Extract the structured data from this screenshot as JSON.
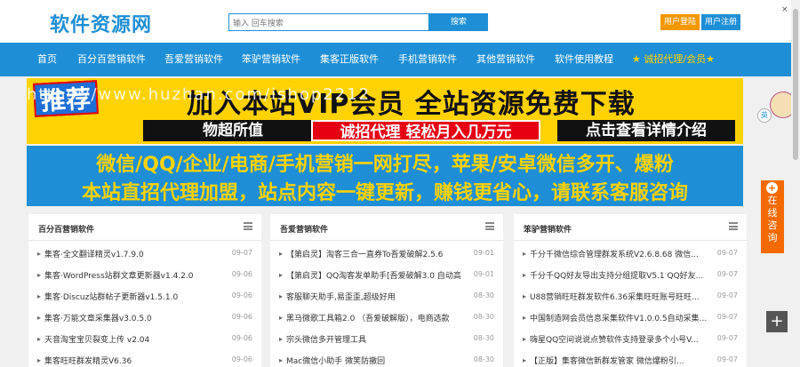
{
  "header": {
    "logo": "软件资源网",
    "search_placeholder": "输入 回车搜索",
    "search_button": "搜索",
    "login": "用户登陆",
    "register": "用户注册",
    "close": "×"
  },
  "nav": [
    "首页",
    "百分百营销软件",
    "吾爱营销软件",
    "笨驴营销软件",
    "集客正版软件",
    "手机营销软件",
    "其他营销软件",
    "软件使用教程",
    "★ 诚招代理/会员★"
  ],
  "banner1": {
    "tag": "推荐",
    "headline": "加入本站VIP会员 全站资源免费下载",
    "watermark": "https://www.huzhan.com/ishop2212",
    "pill1": "物超所值",
    "pill2": "诚招代理 轻松月入几万元",
    "pill3": "点击查看详情介绍"
  },
  "banner2": {
    "line1": "微信/QQ/企业/电商/手机营销一网打尽，苹果/安卓微信多开、爆粉",
    "line2": "本站直招代理加盟，站点内容一键更新，赚钱更省心，请联系客服咨询"
  },
  "mascot_badge": "英",
  "side_chat": [
    "在",
    "线",
    "咨",
    "询"
  ],
  "float_plus": "+",
  "panels": [
    {
      "title": "百分百营销软件",
      "rows": [
        {
          "text": "集客·全文翻译精灵v1.7.9.0",
          "date": "09-07"
        },
        {
          "text": "集客·WordPress站群文章更新器v1.4.2.0",
          "date": "09-06"
        },
        {
          "text": "集客·Discuz站群帖子更新器v1.5.1.0",
          "date": "09-06"
        },
        {
          "text": "集客·万能文章采集器v3.0.5.0",
          "date": "09-06"
        },
        {
          "text": "天音淘宝宝贝裂变上传 v2.04",
          "date": "09-06"
        },
        {
          "text": "集客旺旺群发精灵V6.36",
          "date": "09-06"
        }
      ]
    },
    {
      "title": "吾爱营销软件",
      "rows": [
        {
          "text": "【第启灵】淘客三合一直券To吾爱破解2.5.6",
          "date": "09-01"
        },
        {
          "text": "【第启灵】QQ淘客发单助手[吾爱破解3.0 自动高",
          "date": "09-01"
        },
        {
          "text": "客服聊天助手,易歪歪,超级好用",
          "date": "08-30"
        },
        {
          "text": "黑马微歌工具箱2.0 （吾爱破解版），电商选款",
          "date": "08-30"
        },
        {
          "text": "宗头微信多开管理工具",
          "date": "08-30"
        },
        {
          "text": "Mac微信小助手 微笑防撤回",
          "date": "08-30"
        }
      ]
    },
    {
      "title": "笨驴营销软件",
      "rows": [
        {
          "text": "千分千微信综合管理群发系统V2.6.8.68 微信...",
          "date": "09-07"
        },
        {
          "text": "千分千QQ好友导出支持分组提取V5.1 QQ好友...",
          "date": "09-07"
        },
        {
          "text": "U88营销旺旺群发软件6.36采集旺旺账号旺旺...",
          "date": "09-07"
        },
        {
          "text": "中国制造网会员信息采集软件V1.0.0.5自动采集...",
          "date": "09-07"
        },
        {
          "text": "嗨星QQ空间说说点赞软件支持登录多个小号V...",
          "date": "09-07"
        },
        {
          "text": "【正版】集客微信新群发管家 微信爆粉引...",
          "date": "09-07"
        }
      ]
    }
  ]
}
